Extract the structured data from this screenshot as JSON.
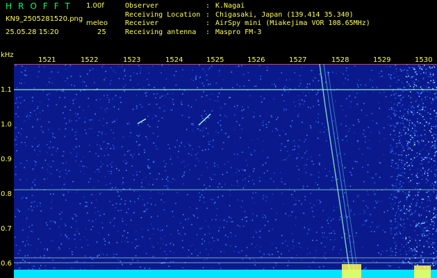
{
  "header": {
    "app_title": "HROFFT",
    "version": "1.00f",
    "filename": "KN9_2505281520.png",
    "meleo_label": "meleo",
    "datetime": "25.05.28 15:20",
    "meleo_value": "25"
  },
  "info": [
    {
      "key": "Observer",
      "value": "K.Nagai"
    },
    {
      "key": "Receiving Location",
      "value": "Chigasaki, Japan (139.414 35.340)"
    },
    {
      "key": "Receiver",
      "value": "AirSpy mini (Miakejima VOR 108.65MHz)"
    },
    {
      "key": "Receiving antenna",
      "value": "Maspro FM-3"
    }
  ],
  "separator": ":",
  "spectrogram": {
    "y_unit": "kHz",
    "y_ticks": [
      "1.1",
      "1.0",
      "0.9",
      "0.8",
      "0.7",
      "0.6"
    ],
    "x_ticks": [
      "1521",
      "1522",
      "1523",
      "1524",
      "1525",
      "1526",
      "1527",
      "1528",
      "1529",
      "1530"
    ],
    "colors": {
      "background": "#0a1a8c",
      "noise": "#2a5cff",
      "signal": "#9fffd0",
      "baseline": "#00e5ff",
      "label": "#ffff55",
      "title": "#00ff66"
    }
  }
}
